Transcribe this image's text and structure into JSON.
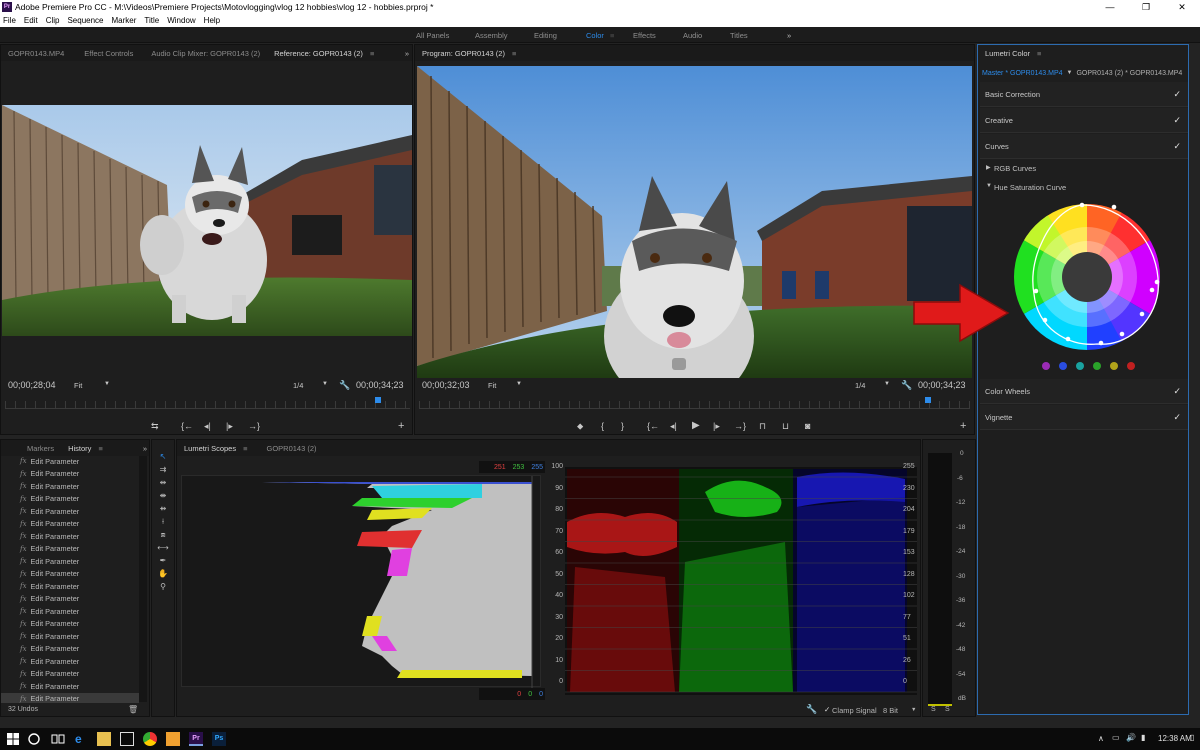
{
  "window": {
    "title": "Adobe Premiere Pro CC - M:\\Videos\\Premiere Projects\\Motovlogging\\vlog 12 hobbies\\vlog 12 - hobbies.prproj *",
    "app_icon": "Pr",
    "minimize": "—",
    "maximize": "❐",
    "close": "✕"
  },
  "menu": [
    "File",
    "Edit",
    "Clip",
    "Sequence",
    "Marker",
    "Title",
    "Window",
    "Help"
  ],
  "workspaces": [
    "All Panels",
    "Assembly",
    "Editing",
    "Color",
    "Effects",
    "Audio",
    "Titles",
    "»"
  ],
  "active_workspace": "Color",
  "source_panel": {
    "tabs": [
      "GOPR0143.MP4",
      "Effect Controls",
      "Audio Clip Mixer: GOPR0143 (2)",
      "Reference: GOPR0143 (2)"
    ],
    "timecode": "00;00;28;04",
    "fit": "Fit",
    "resolution": "1/4",
    "duration": "00;00;34;23"
  },
  "program_panel": {
    "tab": "Program: GOPR0143 (2)",
    "timecode": "00;00;32;03",
    "fit": "Fit",
    "resolution": "1/4",
    "duration": "00;00;34;23"
  },
  "lumetri": {
    "title": "Lumetri Color",
    "master_tab": "Master * GOPR0143.MP4",
    "clip_tab": "GOPR0143 (2) * GOPR0143.MP4",
    "sections": [
      {
        "label": "Basic Correction",
        "checked": "✓"
      },
      {
        "label": "Creative",
        "checked": "✓"
      },
      {
        "label": "Curves",
        "checked": "✓"
      }
    ],
    "rgb_curves": "RGB Curves",
    "hue_sat": "Hue Saturation Curve",
    "color_wheels": "Color Wheels",
    "vignette": "Vignette",
    "swatches": [
      "#9a2bb5",
      "#2a4de0",
      "#1aa3a0",
      "#2aa32a",
      "#b0a21a",
      "#c02020"
    ]
  },
  "history": {
    "tabs": [
      "Markers",
      "History"
    ],
    "items": [
      "Edit Parameter",
      "Edit Parameter",
      "Edit Parameter",
      "Edit Parameter",
      "Edit Parameter",
      "Edit Parameter",
      "Edit Parameter",
      "Edit Parameter",
      "Edit Parameter",
      "Edit Parameter",
      "Edit Parameter",
      "Edit Parameter",
      "Edit Parameter",
      "Edit Parameter",
      "Edit Parameter",
      "Edit Parameter",
      "Edit Parameter",
      "Edit Parameter",
      "Edit Parameter",
      "Edit Parameter"
    ],
    "undos": "32 Undos"
  },
  "scopes": {
    "tabs": [
      "Lumetri Scopes",
      "GOPR0143 (2)"
    ],
    "rgb_top": [
      "251",
      "253",
      "255"
    ],
    "rgb_bottom": [
      "0",
      "0",
      "0"
    ],
    "percent_labels": [
      "100",
      "90",
      "80",
      "70",
      "60",
      "50",
      "40",
      "30",
      "20",
      "10",
      "0"
    ],
    "value_labels": [
      "255",
      "230",
      "204",
      "179",
      "153",
      "128",
      "102",
      "77",
      "51",
      "26",
      "0"
    ],
    "clamp": "Clamp Signal",
    "bit": "8 Bit"
  },
  "audio_meter": {
    "labels": [
      "0",
      "-6",
      "-12",
      "-18",
      "-24",
      "-30",
      "-36",
      "-42",
      "-48",
      "-54",
      "dB"
    ],
    "solo": [
      "S",
      "S"
    ]
  },
  "taskbar": {
    "time": "12:38 AM"
  }
}
